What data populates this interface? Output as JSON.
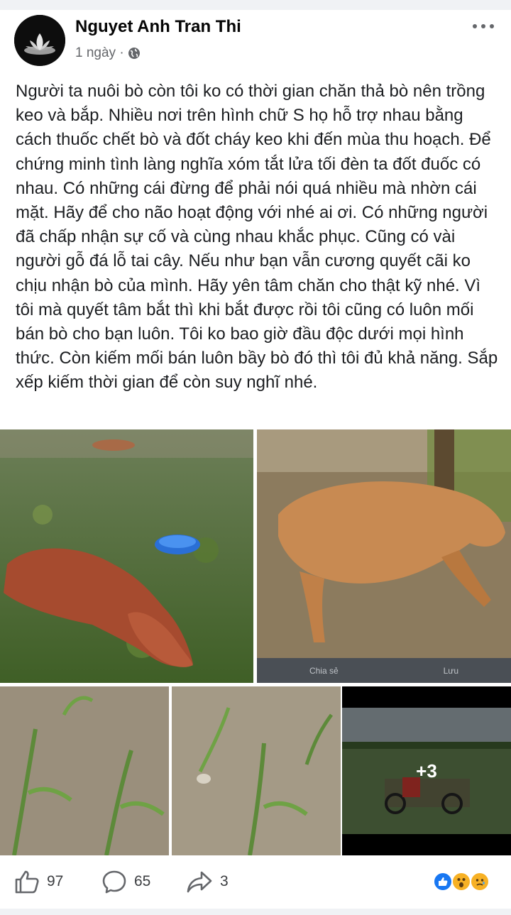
{
  "post": {
    "author": "Nguyet Anh Tran Thi",
    "time": "1 ngày ·",
    "privacy_icon": "globe-icon",
    "text": "Người ta nuôi bò còn tôi ko có thời gian chăn thả bò nên trồng keo và bắp. Nhiều nơi trên hình chữ S họ hỗ trợ nhau bằng cách thuốc chết bò và đốt cháy keo khi đến mùa thu hoạch. Để chứng minh tình làng nghĩa xóm tắt lửa tối đèn ta đốt đuốc có nhau. Có những cái đừng để phải nói quá nhiều mà nhờn cái mặt. Hãy để cho não hoạt động với nhé ai ơi. Có những người đã chấp nhận sự cố và cùng nhau khắc phục. Cũng có vài người gỗ đá lỗ tai cây. Nếu như bạn vẫn cương quyết cãi ko chịu nhận bò của mình. Hãy yên tâm chăn cho thật kỹ nhé. Vì tôi mà quyết tâm bắt thì khi bắt được rồi tôi cũng có luôn mối bán bò cho bạn luôn. Tôi ko bao giờ đầu độc dưới mọi hình thức. Còn kiếm mối bán luôn bầy bò đó thì tôi đủ khả năng. Sắp xếp kiếm thời gian để còn suy nghĩ nhé."
  },
  "photos": {
    "more_count": "+3",
    "embedded_share_label": "Chia sẻ",
    "embedded_save_label": "Lưu"
  },
  "actions": {
    "likes": "97",
    "comments": "65",
    "shares": "3"
  },
  "colors": {
    "like_blue": "#1877f2",
    "reaction_yellow": "#f7b125",
    "meta_gray": "#65676b"
  }
}
